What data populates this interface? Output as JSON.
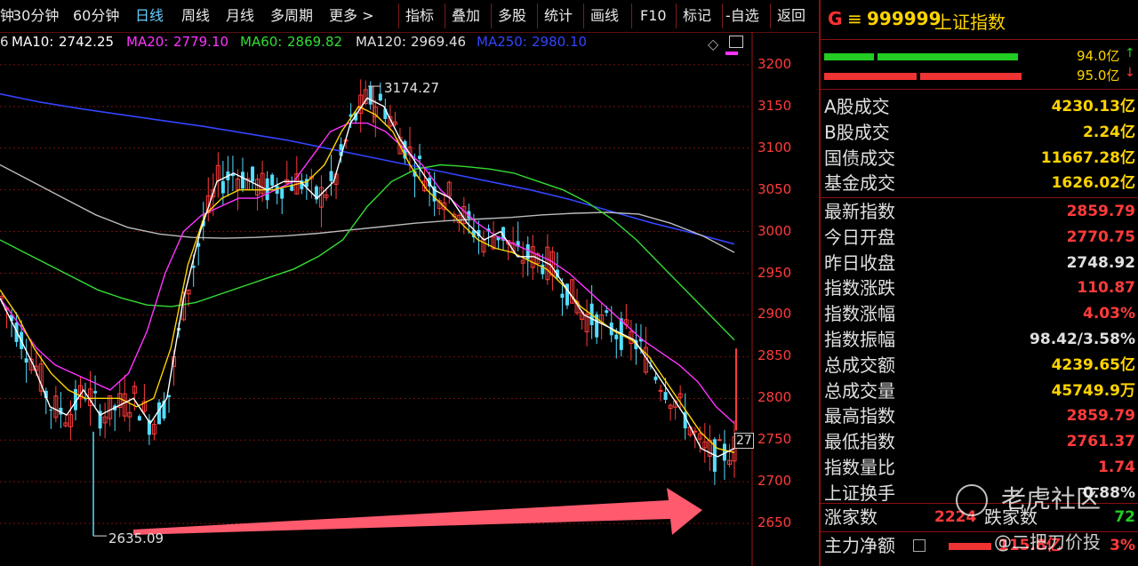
{
  "toolbar": {
    "partial_first": "钟",
    "items": [
      "30分钟",
      "60分钟",
      "日线",
      "周线",
      "月线",
      "多周期",
      "更多 >"
    ],
    "active": "日线",
    "right_items": [
      "指标",
      "叠加",
      "多股",
      "统计",
      "画线",
      "F10",
      "标记",
      "-自选",
      "返回"
    ]
  },
  "ma": {
    "partial": "6",
    "ma10": {
      "label": "MA10:",
      "value": "2742.25",
      "color": "#ffffff"
    },
    "ma20": {
      "label": "MA20:",
      "value": "2779.10",
      "color": "#ff33ff"
    },
    "ma60": {
      "label": "MA60:",
      "value": "2869.82",
      "color": "#33dd33"
    },
    "ma120": {
      "label": "MA120:",
      "value": "2969.46",
      "color": "#e0e0e0"
    },
    "ma250": {
      "label": "MA250:",
      "value": "2980.10",
      "color": "#3344ff"
    }
  },
  "chart_data": {
    "type": "candlestick",
    "y_ticks": [
      "3200",
      "3150",
      "3100",
      "3050",
      "3000",
      "2950",
      "2900",
      "2850",
      "2800",
      "2750",
      "2700",
      "2650"
    ],
    "ylim": [
      2632,
      3218
    ],
    "annotations": {
      "high": "3174.27",
      "low": "2635.09",
      "last_tag": "27"
    },
    "series": {
      "ma5": [
        2920,
        2880,
        2840,
        2790,
        2780,
        2810,
        2780,
        2790,
        2800,
        2770,
        2800,
        2920,
        3000,
        3060,
        3070,
        3060,
        3050,
        3060,
        3060,
        3040,
        3060,
        3130,
        3160,
        3150,
        3110,
        3080,
        3050,
        3040,
        3010,
        2990,
        3000,
        2970,
        2970,
        2960,
        2930,
        2900,
        2890,
        2880,
        2870,
        2840,
        2810,
        2780,
        2740,
        2730,
        2740
      ],
      "ma10": [
        2930,
        2900,
        2860,
        2830,
        2810,
        2800,
        2800,
        2800,
        2790,
        2800,
        2860,
        2960,
        3020,
        3040,
        3050,
        3050,
        3050,
        3055,
        3060,
        3080,
        3120,
        3150,
        3140,
        3120,
        3080,
        3050,
        3030,
        3010,
        2990,
        2980,
        2975,
        2965,
        2955,
        2935,
        2910,
        2895,
        2880,
        2870,
        2850,
        2820,
        2790,
        2760,
        2740,
        2735
      ],
      "ma20": [
        2920,
        2890,
        2860,
        2840,
        2830,
        2820,
        2810,
        2830,
        2880,
        2950,
        3000,
        3020,
        3030,
        3040,
        3040,
        3050,
        3060,
        3090,
        3120,
        3130,
        3130,
        3120,
        3100,
        3080,
        3050,
        3030,
        3010,
        2995,
        2985,
        2975,
        2965,
        2950,
        2930,
        2910,
        2890,
        2870,
        2855,
        2840,
        2820,
        2790,
        2770
      ],
      "ma60": [
        2990,
        2975,
        2960,
        2945,
        2930,
        2920,
        2912,
        2910,
        2915,
        2925,
        2935,
        2945,
        2955,
        2970,
        2990,
        3030,
        3060,
        3075,
        3080,
        3078,
        3075,
        3070,
        3060,
        3050,
        3035,
        3015,
        2990,
        2960,
        2930,
        2900,
        2870
      ],
      "ma120": [
        3080,
        3060,
        3040,
        3020,
        3005,
        2997,
        2993,
        2992,
        2993,
        2995,
        2998,
        3002,
        3006,
        3010,
        3013,
        3015,
        3017,
        3020,
        3022,
        3023,
        3021,
        3010,
        2995,
        2975
      ],
      "ma250": [
        3165,
        3155,
        3147,
        3140,
        3133,
        3126,
        3118,
        3110,
        3100,
        3090,
        3080,
        3070,
        3060,
        3050,
        3038,
        3024,
        3010,
        2998,
        2985
      ]
    }
  },
  "panel": {
    "g_badge": "G",
    "eq": "≡",
    "code": "999999",
    "name": "上证指数",
    "bar1_val": "94.0亿",
    "bar1_arrow": "↑",
    "bar2_val": "95.0亿",
    "bar2_arrow": "↓",
    "bar_green": "#22cc22",
    "bar_red": "#ee3333",
    "rows_a": [
      {
        "label": "A股成交",
        "value": "4230.13亿",
        "color": "#ffd400"
      },
      {
        "label": "B股成交",
        "value": "2.24亿",
        "color": "#ffd400"
      },
      {
        "label": "国债成交",
        "value": "11667.28亿",
        "color": "#ffd400"
      },
      {
        "label": "基金成交",
        "value": "1626.02亿",
        "color": "#ffd400"
      }
    ],
    "rows_b": [
      {
        "label": "最新指数",
        "value": "2859.79",
        "color": "#ff3b3b"
      },
      {
        "label": "今日开盘",
        "value": "2770.75",
        "color": "#ff3b3b"
      },
      {
        "label": "昨日收盘",
        "value": "2748.92",
        "color": "#e0e0e0"
      },
      {
        "label": "指数涨跌",
        "value": "110.87",
        "color": "#ff3b3b"
      },
      {
        "label": "指数涨幅",
        "value": "4.03%",
        "color": "#ff3b3b"
      },
      {
        "label": "指数振幅",
        "value": "98.42/3.58%",
        "color": "#e0e0e0"
      },
      {
        "label": "总成交额",
        "value": "4239.65亿",
        "color": "#ffd400"
      },
      {
        "label": "总成交量",
        "value": "45749.9万",
        "color": "#ffd400"
      },
      {
        "label": "最高指数",
        "value": "2859.79",
        "color": "#ff3b3b"
      },
      {
        "label": "最低指数",
        "value": "2761.37",
        "color": "#ff3b3b"
      },
      {
        "label": "指数量比",
        "value": "1.74",
        "color": "#ff3b3b"
      },
      {
        "label": "上证换手",
        "value": "0.88%",
        "color": "#e0e0e0"
      }
    ],
    "rise_label": "涨家数",
    "rise_value": "2224",
    "fall_label": "跌家数",
    "fall_value": "72",
    "main_label": "主力净额",
    "main_value": "115.8亿",
    "main_pct": "3%"
  },
  "watermark": {
    "brand": "老虎社区",
    "user": "@二把刀价投"
  }
}
